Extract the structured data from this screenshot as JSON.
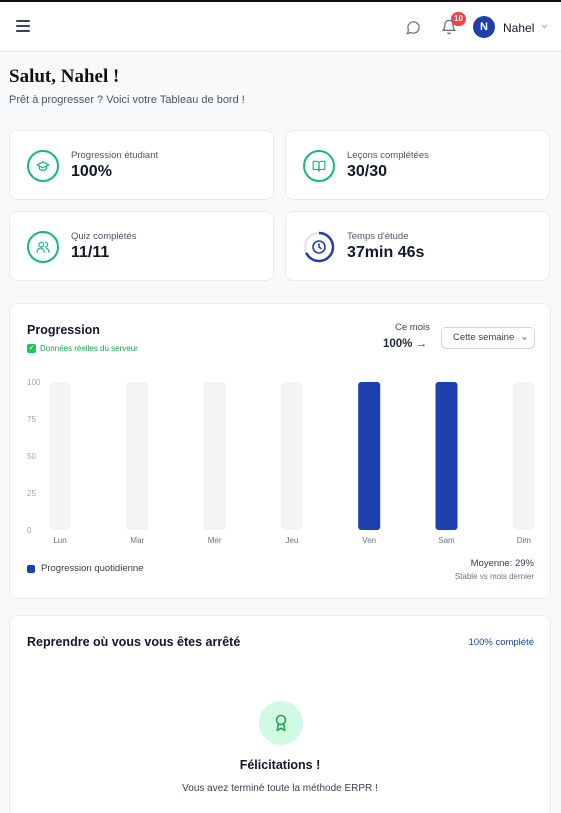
{
  "header": {
    "menu_icon": "hamburger-icon",
    "chat_icon": "chat-bubble-icon",
    "notifications_icon": "bell-icon",
    "notification_count": "10",
    "avatar_initial": "N",
    "user_name": "Nahel",
    "chevron_icon": "chevron-down-icon"
  },
  "greeting": {
    "title": "Salut, Nahel !",
    "subtitle": "Prêt à progresser ? Voici votre Tableau de bord !"
  },
  "stats": [
    {
      "label": "Progression étudiant",
      "value": "100%",
      "icon": "graduation-cap-icon"
    },
    {
      "label": "Leçons complétées",
      "value": "30/30",
      "icon": "book-icon"
    },
    {
      "label": "Quiz complétés",
      "value": "11/11",
      "icon": "users-icon"
    },
    {
      "label": "Temps d'étude",
      "value": "37min 46s",
      "icon": "clock-icon"
    }
  ],
  "progression": {
    "title": "Progression",
    "live_label": "Données réelles du serveur",
    "month_label": "Ce mois",
    "month_value": "100% →",
    "period_select": "Cette semaine",
    "legend_label": "Progression quotidienne",
    "average": "Moyenne: 29%",
    "average_sub": "Stable vs mois dernier"
  },
  "chart_data": {
    "type": "bar",
    "categories": [
      "Lun",
      "Mar",
      "Mer",
      "Jeu",
      "Ven",
      "Sam",
      "Dim"
    ],
    "values": [
      0,
      0,
      0,
      0,
      100,
      100,
      0
    ],
    "y_ticks": [
      "100",
      "75",
      "50",
      "25",
      "0"
    ],
    "ylim": [
      0,
      100
    ],
    "series": [
      {
        "name": "Progression quotidienne",
        "values": [
          0,
          0,
          0,
          0,
          100,
          100,
          0
        ]
      }
    ],
    "bar_color": "#1e3fae",
    "track_color": "#f3f4f6",
    "legend_position": "bottom-left"
  },
  "resume": {
    "title": "Reprendre où vous vous êtes arrêté",
    "link": "100% complété",
    "icon": "award-icon",
    "congrats_title": "Félicitations !",
    "congrats_text": "Vous avez terminé toute la méthode ERPR !"
  },
  "colors": {
    "accent": "#1e3fae",
    "success": "#10b981",
    "badge": "#ef4444"
  }
}
